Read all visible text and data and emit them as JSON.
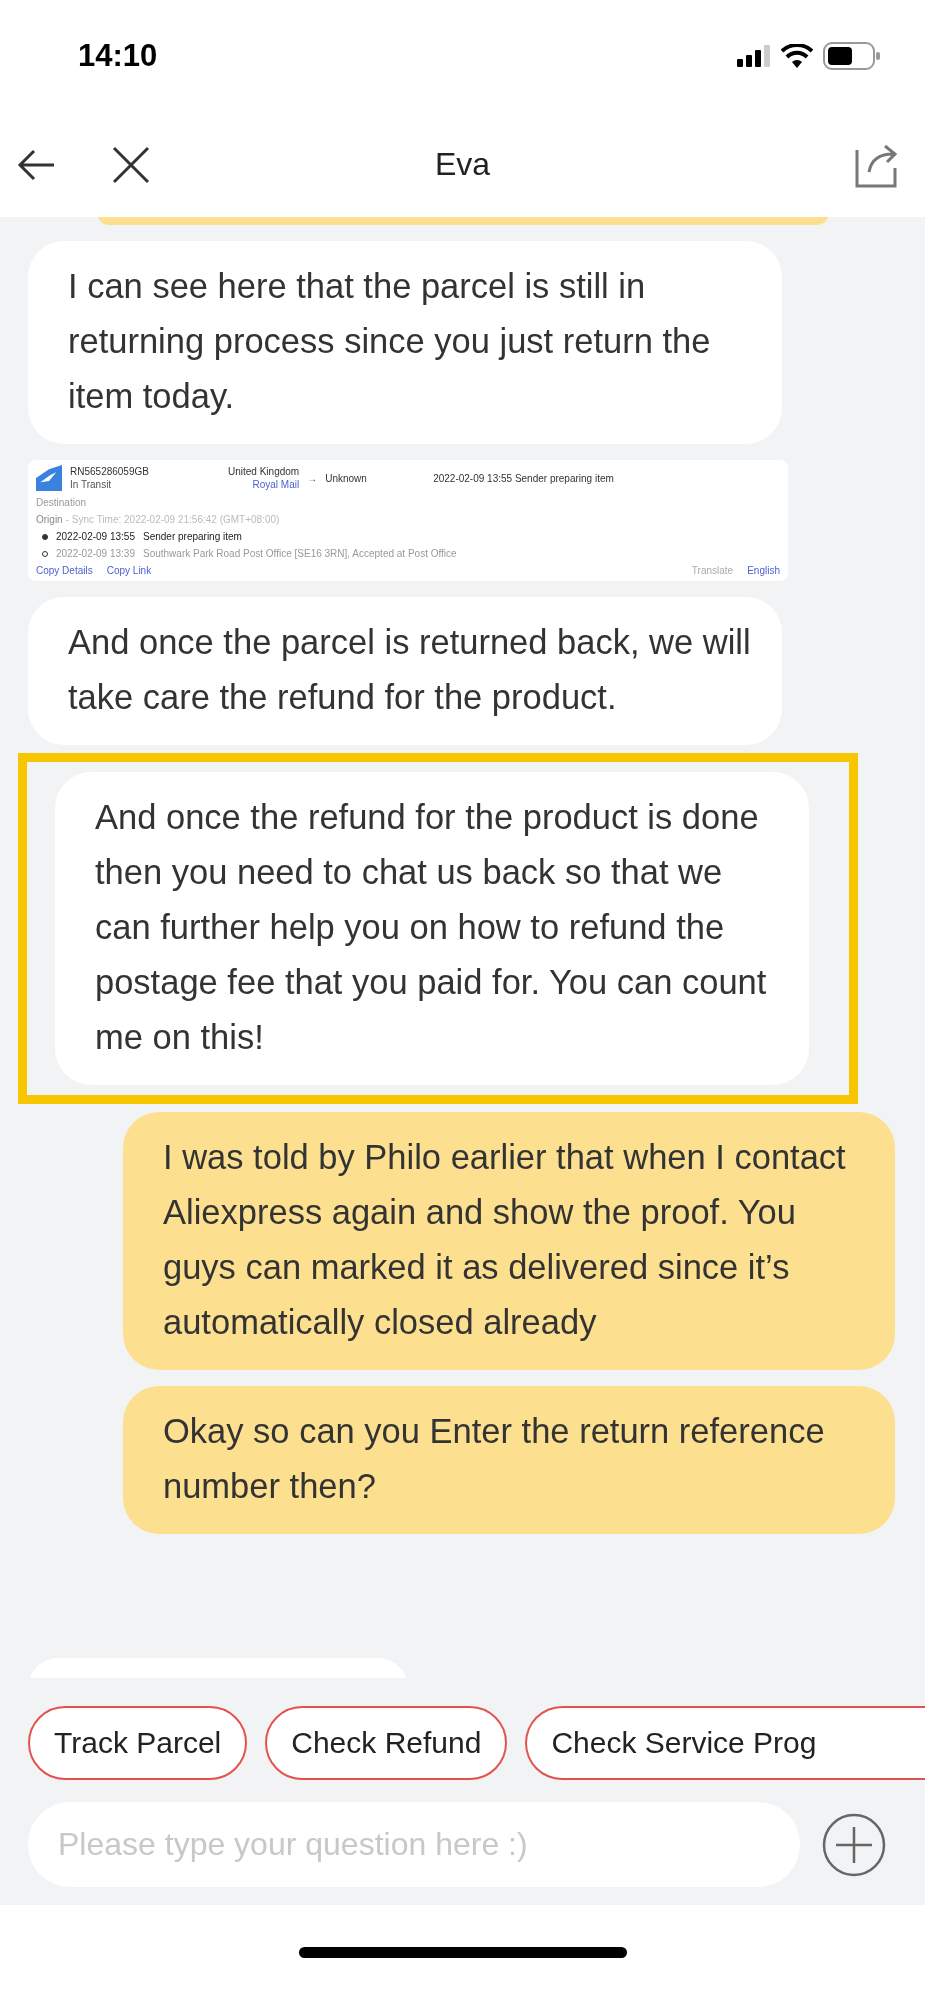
{
  "status_bar": {
    "time": "14:10"
  },
  "header": {
    "title": "Eva"
  },
  "messages": [
    {
      "kind": "partial",
      "from_me": true,
      "highlighted": false
    },
    {
      "kind": "text",
      "from_me": false,
      "highlighted": false,
      "text": "I can see here that the parcel is still in returning process since you just return the item today."
    },
    {
      "kind": "screenshot",
      "highlighted": false,
      "tracking_number": "RN565286059GB",
      "status": "In Transit",
      "origin_country": "United Kingdom",
      "carrier": "Royal Mail",
      "arrow": "→",
      "destination_country": "Unknown",
      "latest_event": "2022-02-09 13:55  Sender preparing item",
      "destination_label": "Destination",
      "origin_label": "Origin",
      "sync_time": "- Sync Time: 2022-02-09 21:56:42 (GMT+08:00)",
      "events": [
        {
          "time": "2022-02-09 13:55",
          "text": "Sender preparing item",
          "selected": true
        },
        {
          "time": "2022-02-09 13:39",
          "text": "Southwark Park Road Post Office [SE16 3RN], Accepted at Post Office",
          "selected": false
        }
      ],
      "links": [
        "Copy Details",
        "Copy Link"
      ],
      "translate_label": "Translate",
      "language": "English"
    },
    {
      "kind": "text",
      "from_me": false,
      "highlighted": false,
      "text": "And once the parcel is returned back, we will take care the refund for the product."
    },
    {
      "kind": "text",
      "from_me": false,
      "highlighted": true,
      "text": "And once the refund for the product is done then you need to chat us back so that we can further help you on how to refund the postage fee that you paid for. You can count me on this!"
    },
    {
      "kind": "text",
      "from_me": true,
      "highlighted": false,
      "text": "I was told by Philo earlier that when I contact Aliexpress again and show the proof.  You guys can marked it as delivered since it’s automatically closed already"
    },
    {
      "kind": "text",
      "from_me": true,
      "highlighted": false,
      "text": "Okay so can you Enter the return reference number then?"
    },
    {
      "kind": "partial",
      "from_me": false,
      "highlighted": false
    }
  ],
  "quick_replies": [
    "Track Parcel",
    "Check Refund",
    "Check Service Prog"
  ],
  "input": {
    "placeholder": "Please type your question here :)"
  }
}
